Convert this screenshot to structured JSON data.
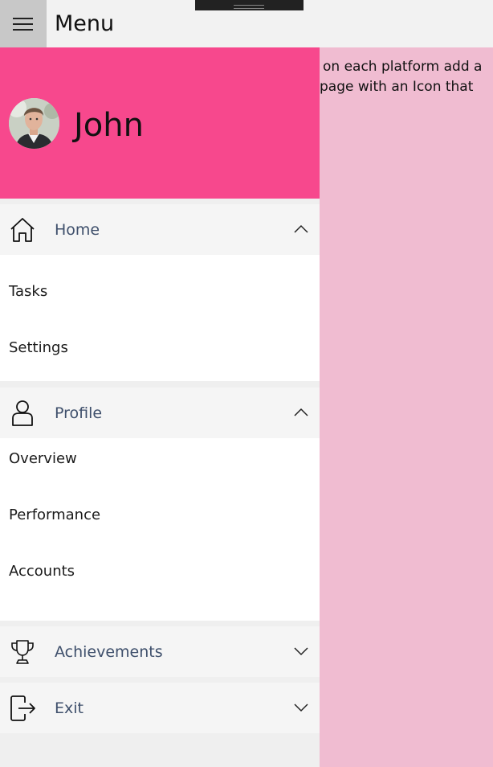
{
  "titlebar": {
    "title": "Menu",
    "menu_icon": "hamburger-icon"
  },
  "content": {
    "line1": "on each platform add a",
    "line2": "page with an Icon that"
  },
  "drawer": {
    "user_name": "John",
    "groups": [
      {
        "label": "Home",
        "icon": "home-icon",
        "expanded": true,
        "items": [
          "Tasks",
          "Settings"
        ]
      },
      {
        "label": "Profile",
        "icon": "person-icon",
        "expanded": true,
        "items": [
          "Overview",
          "Performance",
          "Accounts"
        ]
      },
      {
        "label": "Achievements",
        "icon": "trophy-icon",
        "expanded": false,
        "items": []
      },
      {
        "label": "Exit",
        "icon": "exit-icon",
        "expanded": false,
        "items": []
      }
    ]
  },
  "colors": {
    "header_pink": "#f7488d",
    "content_pink": "#f0bcd1",
    "group_label": "#3e4f6b"
  }
}
